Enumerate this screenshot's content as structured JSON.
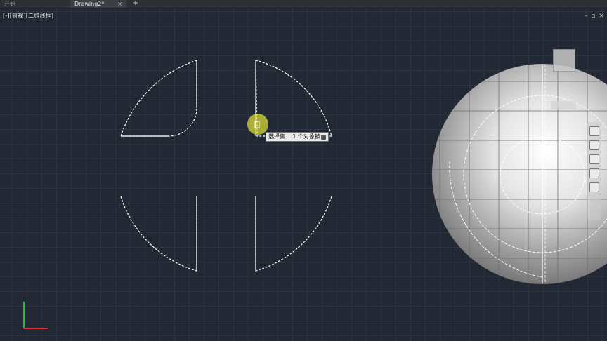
{
  "tabs": [
    {
      "label": "开始"
    },
    {
      "label": "Drawing2*",
      "close": "×"
    }
  ],
  "tab_add": "+",
  "viewport": {
    "label": "[-][俯视][二维线框]"
  },
  "window_controls": {
    "minimize": "–",
    "restore": "▫",
    "close": "×"
  },
  "tooltip": {
    "text": "选择集： 1 个对象被..."
  },
  "colors": {
    "background": "#222934",
    "grid_minor": "#2b3440",
    "grid_major": "#323c49",
    "geometry": "#ffffff",
    "ucs_x": "#e0332d",
    "ucs_y": "#2fb34a",
    "cursor_highlight": "#e1e13c"
  },
  "icons": {
    "add_tab": "plus-icon",
    "cursor": "pickbox-cursor-icon",
    "navigation": "navigation-bar-icon"
  }
}
